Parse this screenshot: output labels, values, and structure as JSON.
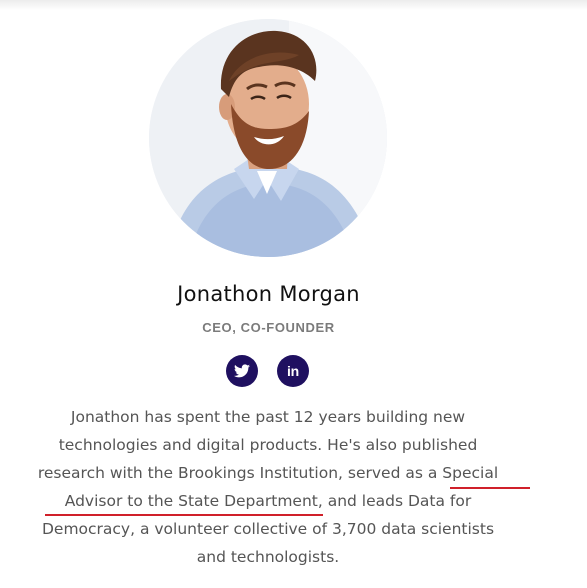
{
  "profile": {
    "name": "Jonathon Morgan",
    "role": "CEO, CO-FOUNDER",
    "photo": "portrait-photo"
  },
  "social": {
    "twitter_icon": "twitter-icon",
    "linkedin_icon": "linkedin-icon",
    "linkedin_glyph": "in",
    "icon_bg": "#1f1060"
  },
  "bio": {
    "lines": [
      "Jonathon has spent the past 12 years building new",
      "technologies and digital products. He's also published",
      "research with the Brookings Institution, served as a Special",
      "Advisor to the State Department, and leads Data for",
      "Democracy, a volunteer collective of 3,700 data scientists",
      "and technologists."
    ],
    "annotation_color": "#d0202a"
  }
}
